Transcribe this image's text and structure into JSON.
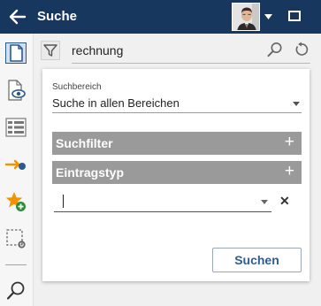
{
  "header": {
    "title": "Suche",
    "back_icon": "arrow-left-icon",
    "window_icon": "window-icon"
  },
  "sidebar": {
    "items": [
      {
        "icon": "document-icon",
        "active": true
      },
      {
        "icon": "document-view-icon"
      },
      {
        "icon": "list-icon"
      },
      {
        "icon": "arrow-pin-icon"
      },
      {
        "icon": "star-add-icon"
      },
      {
        "icon": "selection-settings-icon"
      },
      {
        "icon": "search-icon"
      }
    ]
  },
  "searchbar": {
    "query": "rechnung"
  },
  "panel": {
    "scope_label": "Suchbereich",
    "scope_value": "Suche in allen Bereichen",
    "filter_section": "Suchfilter",
    "type_section": "Eintragstyp",
    "plus_symbol": "+",
    "clear_symbol": "✕",
    "submit_label": "Suchen"
  },
  "colors": {
    "header_bg": "#17375e",
    "section_bar": "#9a9a9a",
    "accent_blue": "#2d5d91",
    "orange": "#f29400"
  }
}
